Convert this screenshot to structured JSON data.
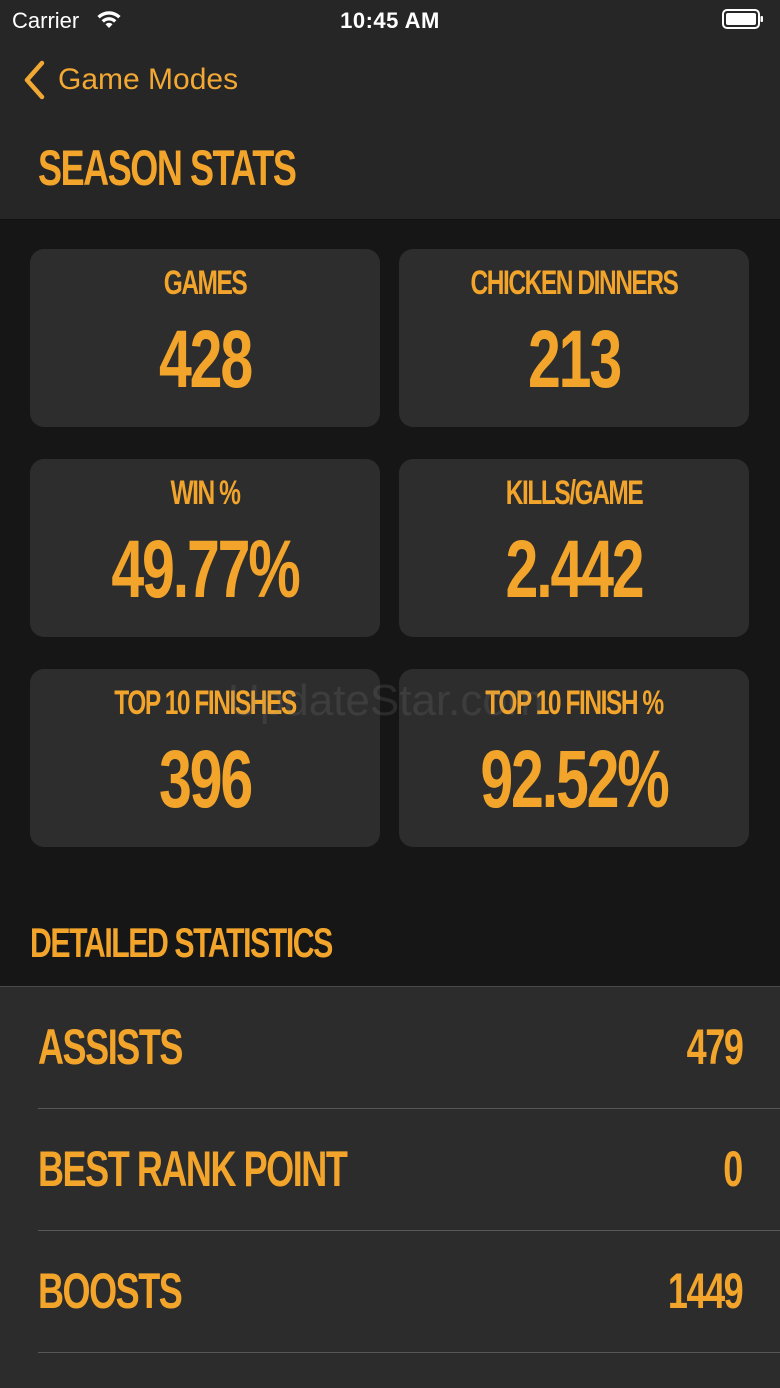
{
  "status_bar": {
    "carrier": "Carrier",
    "time": "10:45 AM"
  },
  "nav": {
    "back_label": "Game Modes"
  },
  "page_title": "SEASON STATS",
  "stats": [
    {
      "label": "GAMES",
      "value": "428"
    },
    {
      "label": "CHICKEN DINNERS",
      "value": "213"
    },
    {
      "label": "WIN %",
      "value": "49.77%"
    },
    {
      "label": "KILLS/GAME",
      "value": "2.442"
    },
    {
      "label": "TOP 10 FINISHES",
      "value": "396"
    },
    {
      "label": "TOP 10 FINISH %",
      "value": "92.52%"
    }
  ],
  "detailed": {
    "header": "DETAILED STATISTICS",
    "rows": [
      {
        "label": "ASSISTS",
        "value": "479"
      },
      {
        "label": "BEST RANK POINT",
        "value": "0"
      },
      {
        "label": "BOOSTS",
        "value": "1449"
      }
    ]
  },
  "watermark": "UpdateStar.com",
  "colors": {
    "accent": "#f2a52a",
    "background": "#161617",
    "card": "#2d2d2e"
  }
}
